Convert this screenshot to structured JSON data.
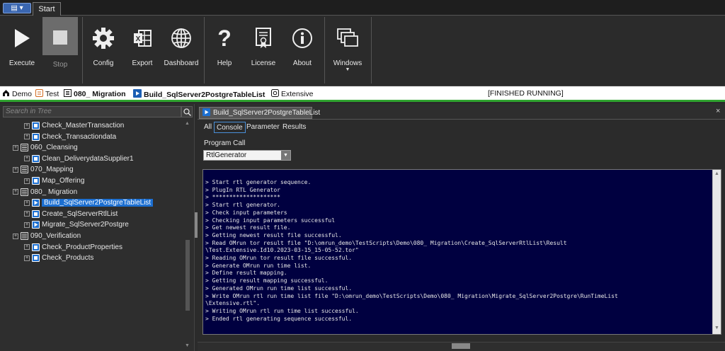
{
  "titlebar": {
    "menu_label": "▤ ▾",
    "tab": "Start"
  },
  "ribbon": {
    "execute": "Execute",
    "stop": "Stop",
    "config": "Config",
    "export": "Export",
    "dashboard": "Dashboard",
    "help": "Help",
    "license": "License",
    "about": "About",
    "windows": "Windows"
  },
  "breadcrumb": {
    "demo": "Demo",
    "test": "Test",
    "migration": "080_ Migration",
    "testcase": "Build_SqlServer2PostgreTableList",
    "extensive": "Extensive",
    "status": "[FINISHED RUNNING]"
  },
  "tree": {
    "search_placeholder": "Search in Tree",
    "items": [
      {
        "label": "Check_MasterTransaction",
        "level": 2,
        "kind": "test"
      },
      {
        "label": "Check_Transactiondata",
        "level": 2,
        "kind": "test"
      },
      {
        "label": "060_Cleansing",
        "level": 1,
        "kind": "folder"
      },
      {
        "label": "Clean_DeliverydataSupplier1",
        "level": 2,
        "kind": "test"
      },
      {
        "label": "070_Mapping",
        "level": 1,
        "kind": "folder"
      },
      {
        "label": "Map_Offering",
        "level": 2,
        "kind": "test"
      },
      {
        "label": "080_ Migration",
        "level": 1,
        "kind": "folder"
      },
      {
        "label": "Build_SqlServer2PostgreTableList",
        "level": 2,
        "kind": "play",
        "selected": true
      },
      {
        "label": "Create_SqlServerRtlList",
        "level": 2,
        "kind": "test"
      },
      {
        "label": "Migrate_SqlServer2Postgre",
        "level": 2,
        "kind": "play"
      },
      {
        "label": "090_Verification",
        "level": 1,
        "kind": "folder"
      },
      {
        "label": "Check_ProductProperties",
        "level": 2,
        "kind": "test"
      },
      {
        "label": "Check_Products",
        "level": 2,
        "kind": "test"
      }
    ]
  },
  "document": {
    "tab_title": "Build_SqlServer2PostgreTableList",
    "close": "×",
    "subtabs": [
      "All",
      "Console",
      "Parameter",
      "Results"
    ],
    "active_subtab": "Console",
    "program_call_label": "Program Call",
    "program_call_value": "RtlGenerator",
    "console_lines": [
      "> Start rtl generator sequence.",
      "> PlugIn RTL Generator",
      "> ********************",
      "> Start rtl generator.",
      "> Check input parameters",
      "> Checking input parameters successful",
      "> Get newest result file.",
      "> Getting newest result file successful.",
      "> Read OMrun tor result file \"D:\\omrun_demo\\TestScripts\\Demo\\080_ Migration\\Create_SqlServerRtlList\\Result",
      "\\Test.Extensive.Id10.2023-03-15_15-05-52.tor\"",
      "> Reading OMrun tor result file successful.",
      "> Generate OMrun run time list.",
      "> Define result mapping.",
      "> Getting result mapping successful.",
      "> Generated OMrun run time list successful.",
      "> Write OMrun rtl run time list file \"D:\\omrun_demo\\TestScripts\\Demo\\080_ Migration\\Migrate_SqlServer2Postgre\\RunTimeList",
      "\\Extensive.rtl\".",
      "> Writing OMrun rtl run time list successful.",
      "> Ended rtl generating sequence successful."
    ]
  },
  "colors": {
    "accent": "#1c6fd1",
    "status_bar": "#2fa32f",
    "console_bg": "#000040"
  }
}
